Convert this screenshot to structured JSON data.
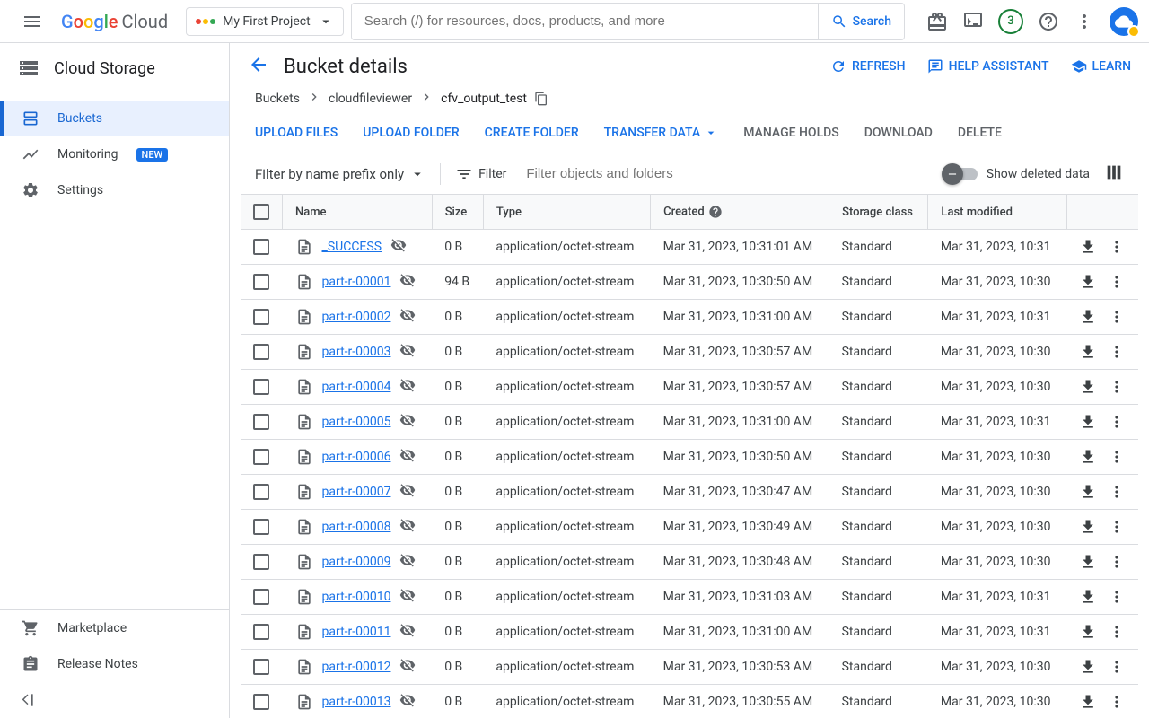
{
  "header": {
    "logo_text": "Cloud",
    "project_name": "My First Project",
    "search_placeholder": "Search (/) for resources, docs, products, and more",
    "search_button": "Search",
    "notification_count": "3"
  },
  "sidebar": {
    "product_title": "Cloud Storage",
    "items": [
      {
        "label": "Buckets",
        "active": true
      },
      {
        "label": "Monitoring",
        "badge": "NEW"
      },
      {
        "label": "Settings"
      }
    ],
    "footer_items": [
      {
        "label": "Marketplace"
      },
      {
        "label": "Release Notes"
      }
    ]
  },
  "page": {
    "title": "Bucket details",
    "actions": {
      "refresh": "REFRESH",
      "help_assistant": "HELP ASSISTANT",
      "learn": "LEARN"
    }
  },
  "breadcrumb": {
    "root": "Buckets",
    "bucket": "cloudfileviewer",
    "folder": "cfv_output_test"
  },
  "toolbar": {
    "upload_files": "UPLOAD FILES",
    "upload_folder": "UPLOAD FOLDER",
    "create_folder": "CREATE FOLDER",
    "transfer_data": "TRANSFER DATA",
    "manage_holds": "MANAGE HOLDS",
    "download": "DOWNLOAD",
    "delete": "DELETE"
  },
  "filter": {
    "prefix_label": "Filter by name prefix only",
    "filter_label": "Filter",
    "placeholder": "Filter objects and folders",
    "show_deleted": "Show deleted data"
  },
  "table": {
    "columns": {
      "name": "Name",
      "size": "Size",
      "type": "Type",
      "created": "Created",
      "storage_class": "Storage class",
      "last_modified": "Last modified"
    },
    "rows": [
      {
        "name": "_SUCCESS",
        "size": "0 B",
        "type": "application/octet-stream",
        "created": "Mar 31, 2023, 10:31:01 AM",
        "storage_class": "Standard",
        "last_modified": "Mar 31, 2023, 10:31"
      },
      {
        "name": "part-r-00001",
        "size": "94 B",
        "type": "application/octet-stream",
        "created": "Mar 31, 2023, 10:30:50 AM",
        "storage_class": "Standard",
        "last_modified": "Mar 31, 2023, 10:30"
      },
      {
        "name": "part-r-00002",
        "size": "0 B",
        "type": "application/octet-stream",
        "created": "Mar 31, 2023, 10:31:00 AM",
        "storage_class": "Standard",
        "last_modified": "Mar 31, 2023, 10:31"
      },
      {
        "name": "part-r-00003",
        "size": "0 B",
        "type": "application/octet-stream",
        "created": "Mar 31, 2023, 10:30:57 AM",
        "storage_class": "Standard",
        "last_modified": "Mar 31, 2023, 10:30"
      },
      {
        "name": "part-r-00004",
        "size": "0 B",
        "type": "application/octet-stream",
        "created": "Mar 31, 2023, 10:30:57 AM",
        "storage_class": "Standard",
        "last_modified": "Mar 31, 2023, 10:30"
      },
      {
        "name": "part-r-00005",
        "size": "0 B",
        "type": "application/octet-stream",
        "created": "Mar 31, 2023, 10:31:00 AM",
        "storage_class": "Standard",
        "last_modified": "Mar 31, 2023, 10:31"
      },
      {
        "name": "part-r-00006",
        "size": "0 B",
        "type": "application/octet-stream",
        "created": "Mar 31, 2023, 10:30:50 AM",
        "storage_class": "Standard",
        "last_modified": "Mar 31, 2023, 10:30"
      },
      {
        "name": "part-r-00007",
        "size": "0 B",
        "type": "application/octet-stream",
        "created": "Mar 31, 2023, 10:30:47 AM",
        "storage_class": "Standard",
        "last_modified": "Mar 31, 2023, 10:30"
      },
      {
        "name": "part-r-00008",
        "size": "0 B",
        "type": "application/octet-stream",
        "created": "Mar 31, 2023, 10:30:49 AM",
        "storage_class": "Standard",
        "last_modified": "Mar 31, 2023, 10:30"
      },
      {
        "name": "part-r-00009",
        "size": "0 B",
        "type": "application/octet-stream",
        "created": "Mar 31, 2023, 10:30:48 AM",
        "storage_class": "Standard",
        "last_modified": "Mar 31, 2023, 10:30"
      },
      {
        "name": "part-r-00010",
        "size": "0 B",
        "type": "application/octet-stream",
        "created": "Mar 31, 2023, 10:31:03 AM",
        "storage_class": "Standard",
        "last_modified": "Mar 31, 2023, 10:31"
      },
      {
        "name": "part-r-00011",
        "size": "0 B",
        "type": "application/octet-stream",
        "created": "Mar 31, 2023, 10:31:00 AM",
        "storage_class": "Standard",
        "last_modified": "Mar 31, 2023, 10:31"
      },
      {
        "name": "part-r-00012",
        "size": "0 B",
        "type": "application/octet-stream",
        "created": "Mar 31, 2023, 10:30:53 AM",
        "storage_class": "Standard",
        "last_modified": "Mar 31, 2023, 10:30"
      },
      {
        "name": "part-r-00013",
        "size": "0 B",
        "type": "application/octet-stream",
        "created": "Mar 31, 2023, 10:30:55 AM",
        "storage_class": "Standard",
        "last_modified": "Mar 31, 2023, 10:30"
      }
    ]
  }
}
